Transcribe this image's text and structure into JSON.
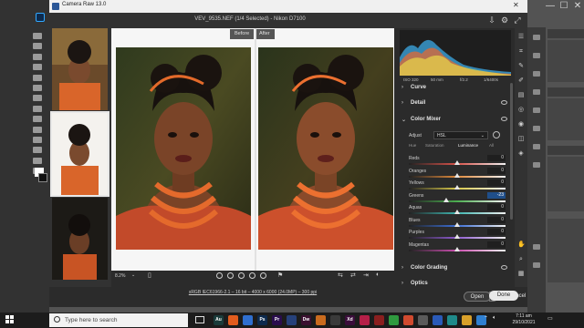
{
  "app": {
    "title": "Camera Raw 13.0",
    "file_info": "VEV_9535.NEF (1/4 Selected)  -  Nikon D7100",
    "window_controls": [
      "—",
      "☐",
      "✕"
    ]
  },
  "view_tabs": {
    "before": "Before",
    "after": "After"
  },
  "zoom": "8.2%",
  "image_info_link": "sRGB IEC61966-2.1 – 16 bit – 4000 x 6000 (24.0MP) – 300 ppi",
  "histogram_meta": {
    "iso": "ISO 320",
    "focal": "50 mm",
    "aperture": "f/2.2",
    "shutter": "1/6400s"
  },
  "panels": {
    "curve": "Curve",
    "detail": "Detail",
    "color_mixer": "Color Mixer",
    "color_grading": "Color Grading",
    "optics": "Optics"
  },
  "color_mixer": {
    "adjust_label": "Adjust",
    "adjust_value": "HSL",
    "subtabs": [
      "Hue",
      "Saturation",
      "Luminance",
      "All"
    ],
    "active_subtab": "Luminance",
    "sliders": [
      {
        "name": "Reds",
        "value": "0",
        "level": 0,
        "color": "#d9534a"
      },
      {
        "name": "Oranges",
        "value": "0",
        "level": 0,
        "color": "#e08a3c"
      },
      {
        "name": "Yellows",
        "value": "0",
        "level": 0,
        "color": "#d8c84a"
      },
      {
        "name": "Greens",
        "value": "-23",
        "level": -23,
        "color": "#4caf50"
      },
      {
        "name": "Aquas",
        "value": "0",
        "level": 0,
        "color": "#3fb6b0"
      },
      {
        "name": "Blues",
        "value": "0",
        "level": 0,
        "color": "#3c6fd6"
      },
      {
        "name": "Purples",
        "value": "0",
        "level": 0,
        "color": "#8e5bd0"
      },
      {
        "name": "Magentas",
        "value": "0",
        "level": 0,
        "color": "#cc4fb0"
      }
    ]
  },
  "buttons": {
    "open": "Open",
    "cancel": "Cancel",
    "done": "Done"
  },
  "taskbar": {
    "search_placeholder": "Type here to search",
    "apps": [
      {
        "label": "Au",
        "color": "#1a3b3a"
      },
      {
        "label": "",
        "color": "#e25c1e"
      },
      {
        "label": "",
        "color": "#2f6fd0"
      },
      {
        "label": "Ps",
        "color": "#0d2a4d"
      },
      {
        "label": "Pr",
        "color": "#2a0d4d"
      },
      {
        "label": "",
        "color": "#26417a"
      },
      {
        "label": "Dw",
        "color": "#3a1030"
      },
      {
        "label": "",
        "color": "#c96b1e"
      },
      {
        "label": "",
        "color": "#3a3a3a"
      },
      {
        "label": "Xd",
        "color": "#3a0d3a"
      },
      {
        "label": "",
        "color": "#b51f48"
      },
      {
        "label": "",
        "color": "#8a1f1f"
      },
      {
        "label": "",
        "color": "#2f9a3f"
      },
      {
        "label": "",
        "color": "#d04a2f"
      },
      {
        "label": "",
        "color": "#5a5a5a"
      },
      {
        "label": "",
        "color": "#2a5ab8"
      },
      {
        "label": "",
        "color": "#1f8a8a"
      },
      {
        "label": "",
        "color": "#d8a02a"
      },
      {
        "label": "",
        "color": "#2f7fd0"
      }
    ],
    "time": "7:11 am",
    "date": "29/10/2021"
  }
}
